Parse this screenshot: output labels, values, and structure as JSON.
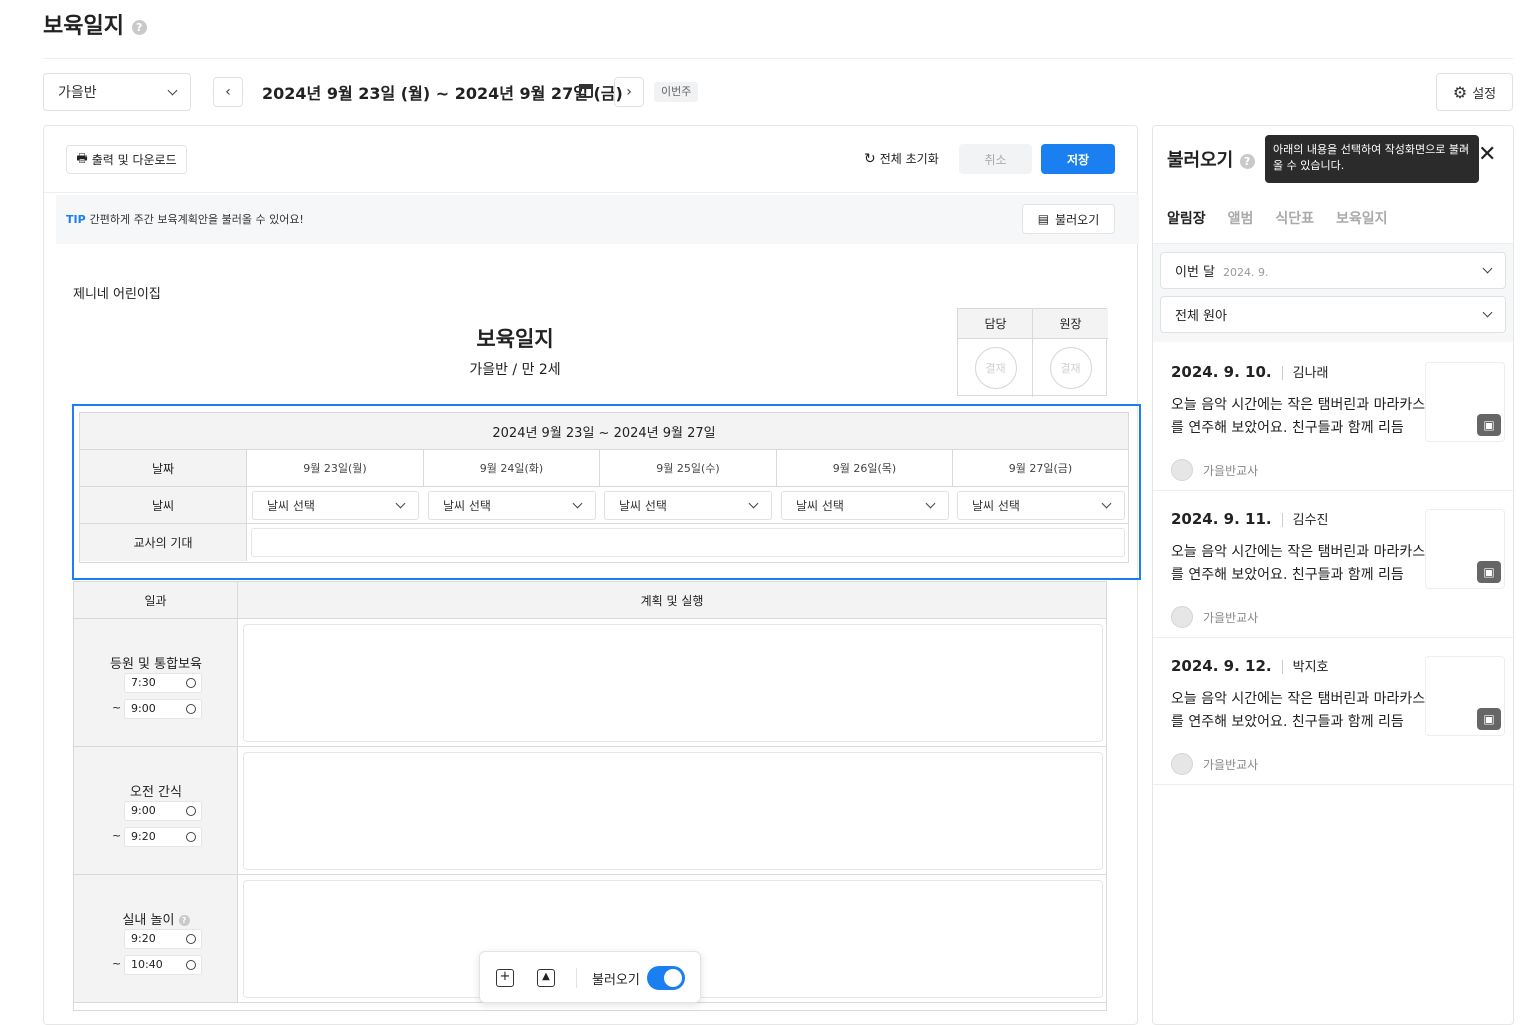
{
  "header": {
    "title": "보육일지"
  },
  "toolbar": {
    "class_select": "가을반",
    "prev": "‹",
    "next": "›",
    "date_range": "2024년 9월 23일 (월) ~ 2024년 9월 27일 (금)",
    "this_week_badge": "이번주",
    "settings_label": "설정"
  },
  "editor": {
    "print_label": "출력 및 다운로드",
    "reset_label": "전체 초기화",
    "cancel_label": "취소",
    "save_label": "저장",
    "tip_prefix": "TIP",
    "tip_text": "간편하게 주간 보육계획안을 불러올 수 있어요!",
    "load_label": "불러오기"
  },
  "document": {
    "org_name": "제니네 어린이집",
    "title": "보육일지",
    "subtitle": "가을반 / 만 2세",
    "approval": {
      "headers": [
        "담당",
        "원장"
      ],
      "stamp": "결재"
    },
    "week": {
      "range": "2024년 9월 23일 ~ 2024년 9월 27일",
      "date_label": "날짜",
      "weather_label": "날씨",
      "expect_label": "교사의 기대",
      "days": [
        "9월 23일(월)",
        "9월 24일(화)",
        "9월 25일(수)",
        "9월 26일(목)",
        "9월 27일(금)"
      ],
      "weather_placeholder": "날씨 선택"
    },
    "schedule": {
      "col1": "일과",
      "col2": "계획 및 실행",
      "rows": [
        {
          "name": "등원 및 통합보육",
          "start": "7:30",
          "end": "9:00"
        },
        {
          "name": "오전 간식",
          "start": "9:00",
          "end": "9:20"
        },
        {
          "name": "실내 놀이",
          "start": "9:20",
          "end": "10:40"
        }
      ],
      "tilde": "~"
    }
  },
  "floating_bar": {
    "load_label": "불러오기"
  },
  "side": {
    "title": "불러오기",
    "tooltip": "아래의 내용을 선택하여 작성화면으로 불러올 수 있습니다.",
    "tabs": [
      "알림장",
      "앨범",
      "식단표",
      "보육일지"
    ],
    "filter_month": "이번 달",
    "filter_month_value": "2024. 9.",
    "filter_kids": "전체 원아",
    "cards": [
      {
        "date": "2024. 9. 10.",
        "child": "김나래",
        "text": "오늘 음악 시간에는 작은 탬버린과 마라카스를 연주해 보았어요. 친구들과 함께 리듬",
        "teacher": "가을반교사"
      },
      {
        "date": "2024. 9. 11.",
        "child": "김수진",
        "text": "오늘 음악 시간에는 작은 탬버린과 마라카스를 연주해 보았어요. 친구들과 함께 리듬",
        "teacher": "가을반교사"
      },
      {
        "date": "2024. 9. 12.",
        "child": "박지호",
        "text": "오늘 음악 시간에는 작은 탬버린과 마라카스를 연주해 보았어요. 친구들과 함께 리듬",
        "teacher": "가을반교사"
      }
    ]
  }
}
